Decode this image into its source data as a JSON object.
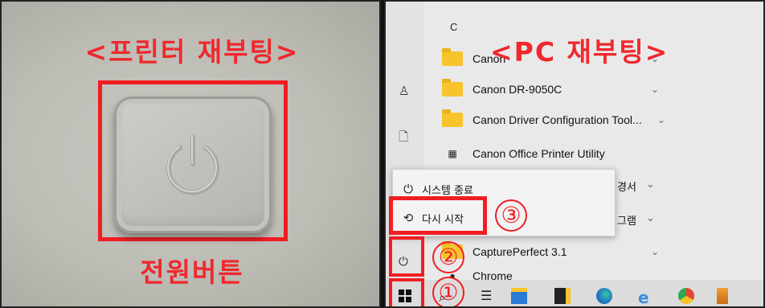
{
  "left_panel": {
    "title": "<프린터 재부팅>",
    "caption": "전원버튼"
  },
  "right_panel": {
    "title": "<PC 재부팅>",
    "list_letter": "C",
    "apps": [
      {
        "label": "Canon",
        "icon": "folder-icon",
        "chevron": "⌄"
      },
      {
        "label": "Canon DR-9050C",
        "icon": "folder-icon",
        "chevron": "⌄"
      },
      {
        "label": "Canon Driver Configuration Tool...",
        "icon": "folder-icon",
        "chevron": "⌄"
      },
      {
        "label": "Canon Office Printer Utility",
        "icon": "app-icon",
        "chevron": ""
      }
    ],
    "power_menu": {
      "shutdown_label": "시스템 종료",
      "restart_label": "다시 시작"
    },
    "partial_items": {
      "item1": "경서",
      "item2": "그램"
    },
    "capture_app": "CapturePerfect 3.1",
    "chrome_app": "Chrome",
    "steps": [
      "①",
      "②",
      "③"
    ],
    "accent_color": "#f01e23"
  }
}
